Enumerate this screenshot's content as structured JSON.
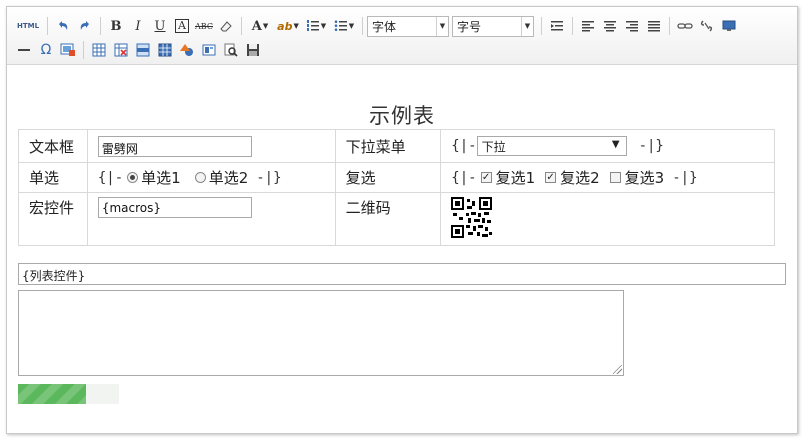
{
  "toolbar": {
    "html_label": "HTML",
    "font_family_value": "字体",
    "font_size_value": "字号"
  },
  "document": {
    "title": "示例表",
    "rows": [
      {
        "label1": "文本框",
        "label2": "下拉菜单"
      },
      {
        "label1": "单选",
        "label2": "复选"
      },
      {
        "label1": "宏控件",
        "label2": "二维码"
      }
    ],
    "textbox_value": "雷劈网",
    "dropdown": {
      "open": "{|-",
      "selected": "下拉",
      "close": "-|}"
    },
    "radio_group": {
      "open": "{|-",
      "options": [
        {
          "label": "单选1",
          "checked": true
        },
        {
          "label": "单选2",
          "checked": false
        }
      ],
      "close": "-|}"
    },
    "checkbox_group": {
      "open": "{|-",
      "options": [
        {
          "label": "复选1",
          "checked": true
        },
        {
          "label": "复选2",
          "checked": true
        },
        {
          "label": "复选3",
          "checked": false
        }
      ],
      "close": "-|}"
    },
    "macro_value": "{macros}",
    "list_control_value": "{列表控件}",
    "progress_fraction": 0.67
  },
  "colors": {
    "progress_green": "#5cb85c",
    "border": "#d9d9d9"
  }
}
